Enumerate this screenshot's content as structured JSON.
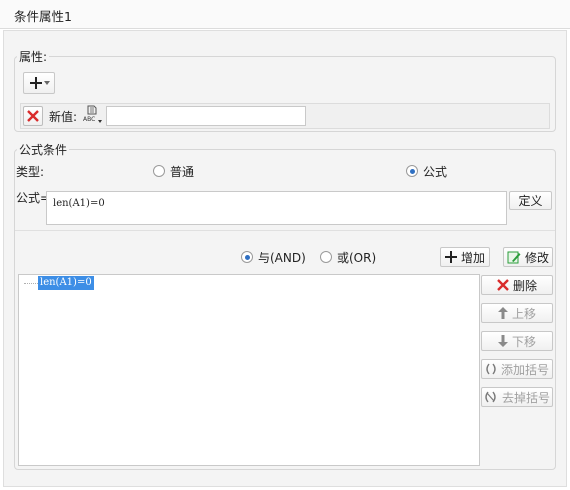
{
  "window": {
    "title": "条件属性1"
  },
  "attributes": {
    "legend": "属性:",
    "add_icon": "plus-dropdown-icon",
    "row": {
      "delete_icon": "red-x-icon",
      "new_value_label": "新值:",
      "type_icon": "abc-type-icon",
      "value": ""
    }
  },
  "formula_condition": {
    "legend": "公式条件",
    "type_label": "类型:",
    "type_options": [
      {
        "label": "普通",
        "checked": false
      },
      {
        "label": "公式",
        "checked": true
      }
    ],
    "formula_label": "公式=",
    "formula_value": "len(A1)=0",
    "define_button": "定义",
    "logic_options": [
      {
        "label": "与(AND)",
        "checked": true
      },
      {
        "label": "或(OR)",
        "checked": false
      }
    ],
    "add_button": "增加",
    "modify_button": "修改",
    "conditions": [
      "len(A1)=0"
    ],
    "side_buttons": {
      "delete": "删除",
      "move_up": "上移",
      "move_down": "下移",
      "add_paren": "添加括号",
      "remove_paren": "去掉括号"
    }
  },
  "colors": {
    "accent": "#2f6fc2",
    "selection": "#3d8ee6",
    "delete_red": "#d92b2b",
    "add_green": "#2a9d3a"
  }
}
